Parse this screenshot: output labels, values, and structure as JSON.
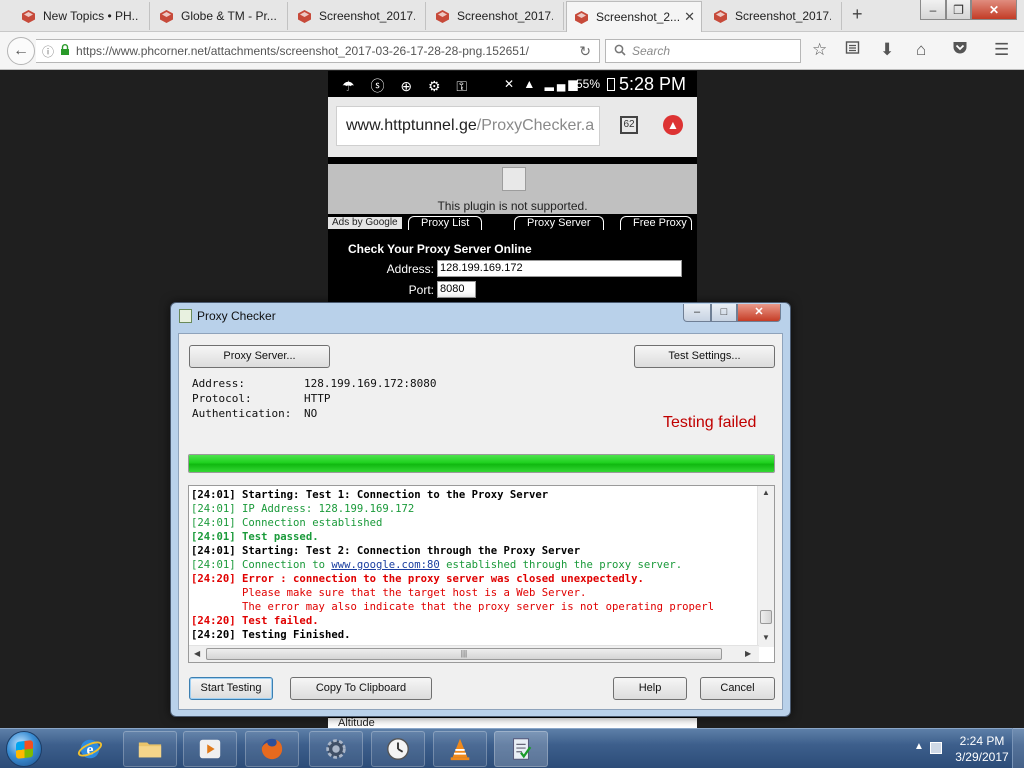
{
  "browser": {
    "tabs": [
      {
        "label": "New Topics • PH..."
      },
      {
        "label": "Globe & TM - Pr..."
      },
      {
        "label": "Screenshot_2017..."
      },
      {
        "label": "Screenshot_2017..."
      },
      {
        "label": "Screenshot_2...",
        "active": true
      },
      {
        "label": "Screenshot_2017..."
      }
    ],
    "url": "https://www.phcorner.net/attachments/screenshot_2017-03-26-17-28-28-png.152651/",
    "search_placeholder": "Search"
  },
  "phone": {
    "battery": "55%",
    "time": "5:28 PM",
    "url_domain": "www.httptunnel.ge",
    "url_path": "/ProxyChecker.a",
    "tab_count": "62",
    "plugin_message": "This plugin is not supported.",
    "ads_label": "Ads by Google",
    "nav_tabs": [
      "Proxy List",
      "Proxy Server",
      "Free Proxy"
    ],
    "form_title": "Check Your Proxy Server Online",
    "address_label": "Address:",
    "address_value": "128.199.169.172",
    "port_label": "Port:",
    "port_value": "8080",
    "altitude_label": "Altitude"
  },
  "dialog": {
    "title": "Proxy Checker",
    "proxy_server_button": "Proxy Server...",
    "test_settings_button": "Test Settings...",
    "info": {
      "address_label": "Address:",
      "address_value": "128.199.169.172:8080",
      "protocol_label": "Protocol:",
      "protocol_value": "HTTP",
      "auth_label": "Authentication:",
      "auth_value": "NO"
    },
    "status": "Testing failed",
    "progress_percent": 100,
    "log": [
      {
        "time": "[24:01]",
        "text": " Starting: Test 1: Connection to the Proxy Server",
        "style": "lb"
      },
      {
        "time": "[24:01]",
        "text": " IP Address: 128.199.169.172",
        "style": "lg"
      },
      {
        "time": "[24:01]",
        "text": " Connection established",
        "style": "lg"
      },
      {
        "time": "[24:01]",
        "text": " Test passed.",
        "style": "lgb"
      },
      {
        "time": "[24:01]",
        "text": " Starting: Test 2: Connection through the Proxy Server",
        "style": "lb"
      },
      {
        "time": "[24:01]",
        "text": " Connection to ",
        "link": "www.google.com:80",
        "after": " established through the proxy server.",
        "style": "lg"
      },
      {
        "time": "[24:20]",
        "text": " Error : connection to the proxy server was closed unexpectedly.",
        "style": "lrb"
      },
      {
        "time": "",
        "text": "        Please make sure that the target host is a Web Server.",
        "style": "lr"
      },
      {
        "time": "",
        "text": "        The error may also indicate that the proxy server is not operating properl",
        "style": "lr"
      },
      {
        "time": "[24:20]",
        "text": " Test failed.",
        "style": "lrb"
      },
      {
        "time": "[24:20]",
        "text": " Testing Finished.",
        "style": "lb"
      }
    ],
    "buttons": {
      "start": "Start Testing",
      "copy": "Copy To Clipboard",
      "help": "Help",
      "cancel": "Cancel"
    }
  },
  "taskbar": {
    "time": "2:24 PM",
    "date": "3/29/2017"
  }
}
